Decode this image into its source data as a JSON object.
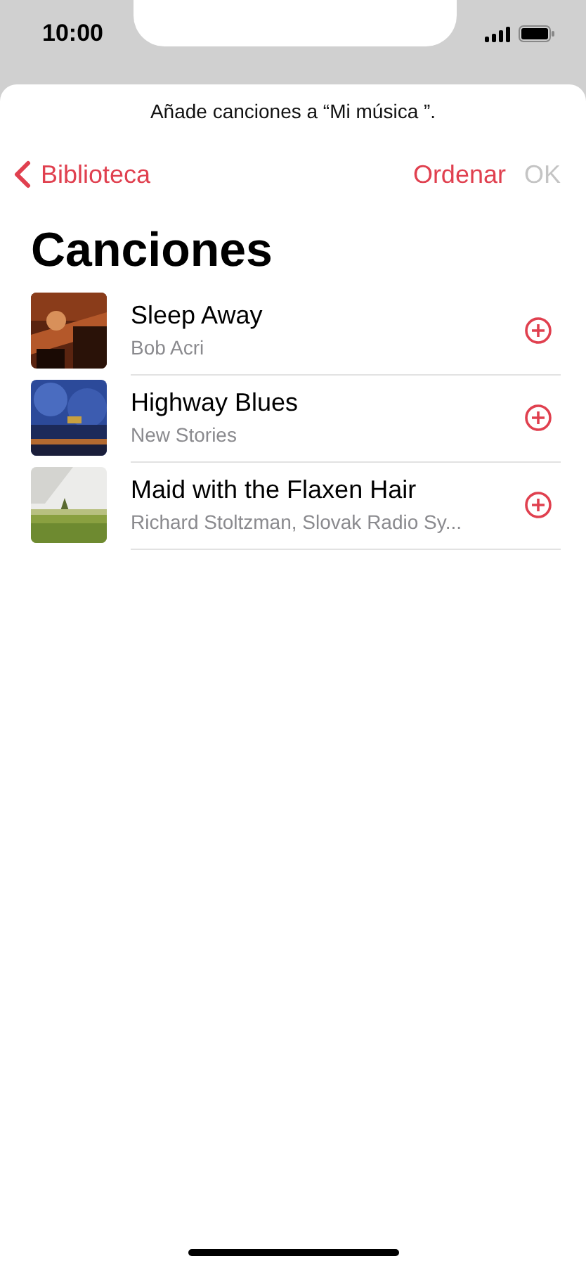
{
  "status_bar": {
    "time": "10:00"
  },
  "prompt": "Añade canciones a “Mi música ”.",
  "nav": {
    "back": "Biblioteca",
    "sort": "Ordenar",
    "done": {
      "label": "OK",
      "disabled": true
    }
  },
  "title": "Canciones",
  "songs": [
    {
      "title": "Sleep Away",
      "artist": "Bob Acri"
    },
    {
      "title": "Highway Blues",
      "artist": "New Stories"
    },
    {
      "title": "Maid with the Flaxen Hair",
      "artist": "Richard Stoltzman, Slovak Radio Sy..."
    }
  ]
}
